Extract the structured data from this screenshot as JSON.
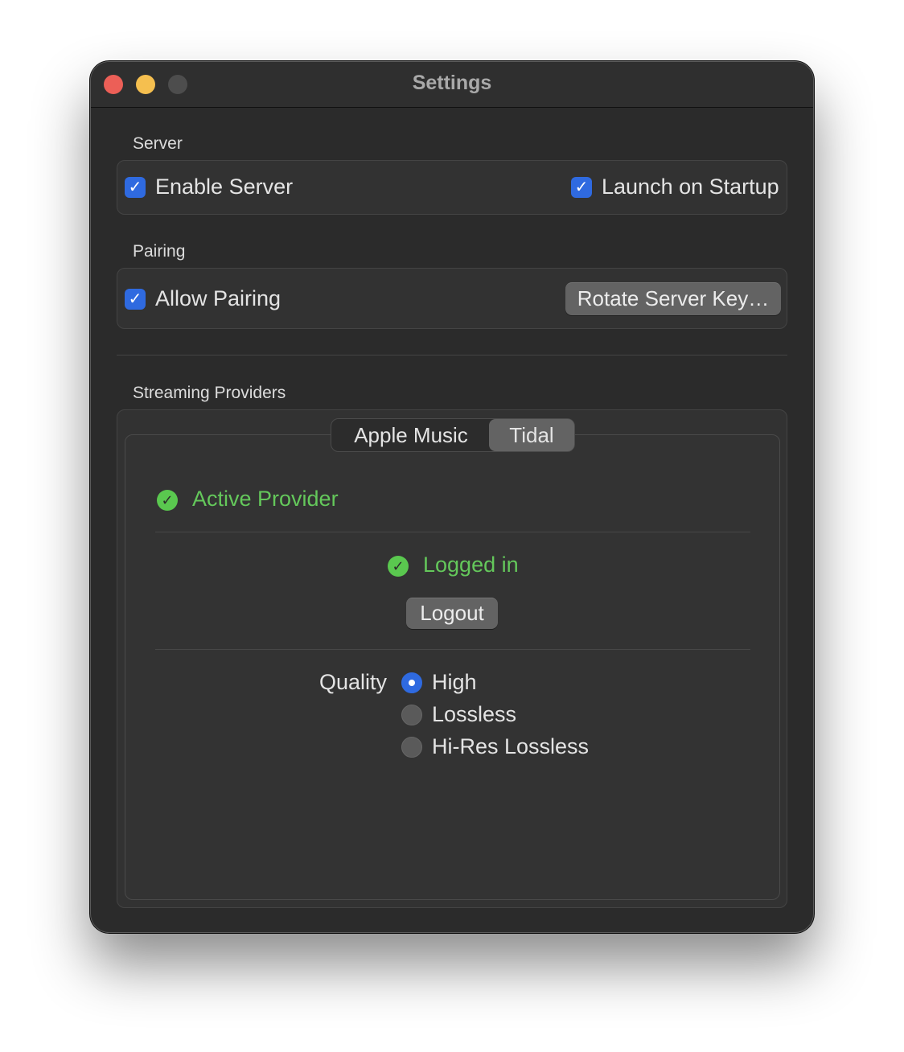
{
  "window": {
    "title": "Settings"
  },
  "server": {
    "section_label": "Server",
    "enable_server": {
      "label": "Enable Server",
      "checked": true
    },
    "launch_on_startup": {
      "label": "Launch on Startup",
      "checked": true
    }
  },
  "pairing": {
    "section_label": "Pairing",
    "allow_pairing": {
      "label": "Allow Pairing",
      "checked": true
    },
    "rotate_button": "Rotate Server Key…"
  },
  "streaming": {
    "section_label": "Streaming Providers",
    "tabs": [
      {
        "label": "Apple Music",
        "selected": false
      },
      {
        "label": "Tidal",
        "selected": true
      }
    ],
    "active_provider": "Active Provider",
    "logged_in": "Logged in",
    "logout_button": "Logout",
    "quality": {
      "label": "Quality",
      "options": [
        "High",
        "Lossless",
        "Hi-Res Lossless"
      ],
      "selected": "High"
    }
  },
  "icons": {
    "check": "✓"
  },
  "colors": {
    "accent": "#2f6ae0",
    "success": "#64c85b",
    "close": "#ec5f57",
    "minimize": "#f5bf4f"
  }
}
